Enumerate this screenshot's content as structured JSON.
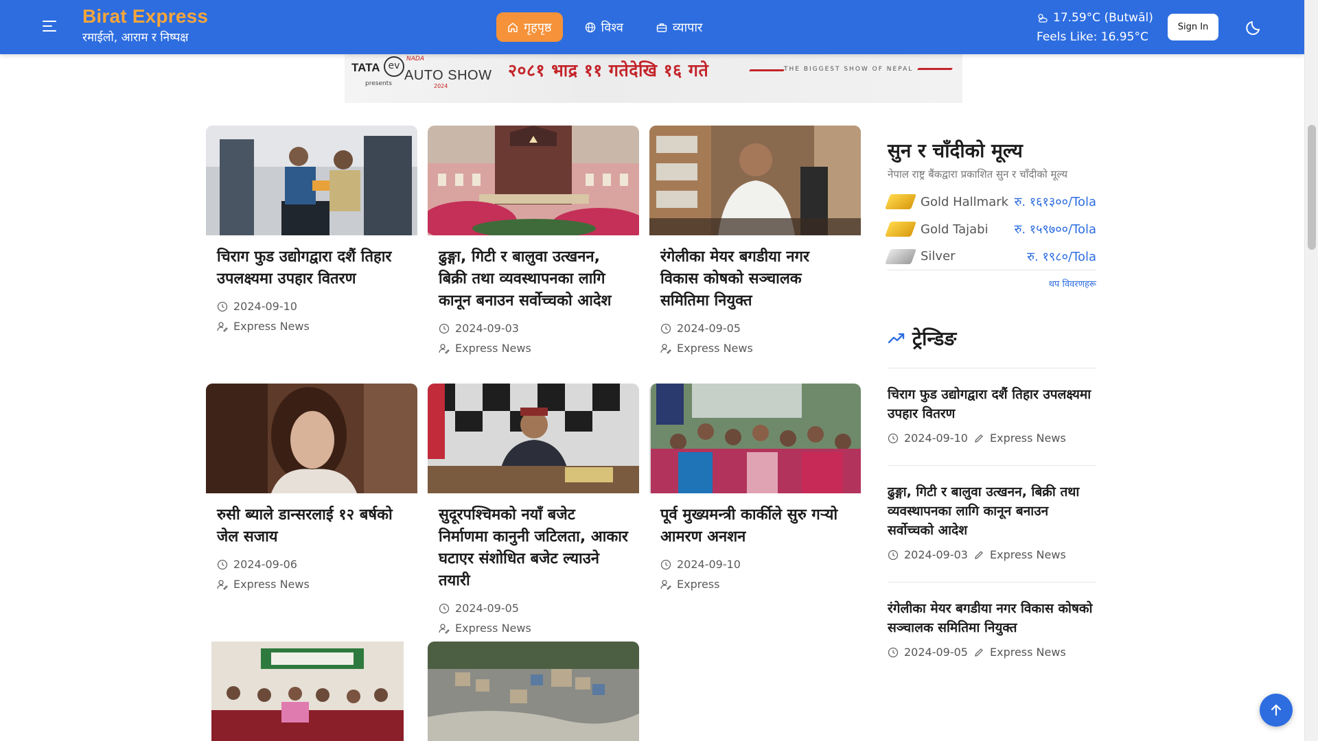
{
  "header": {
    "brand_name": "Birat Express",
    "brand_tagline": "रमाईलो, आराम र निष्पक्ष",
    "nav": [
      {
        "label": "गृहपृष्ठ",
        "icon": "home-icon",
        "active": true
      },
      {
        "label": "विश्व",
        "icon": "globe-icon",
        "active": false
      },
      {
        "label": "व्यापार",
        "icon": "briefcase-icon",
        "active": false
      }
    ],
    "weather_temp": "17.59°C (Butwāl)",
    "weather_feels": "Feels Like: 16.95°C",
    "signin_label": "Sign In",
    "accent_color": "#2d6de0",
    "active_tab_color": "#f6923a",
    "brand_color": "#f7a53a"
  },
  "banner": {
    "brand": "TATA",
    "ev": "ev",
    "presents": "presents",
    "show_name": "AUTO SHOW",
    "organizer": "NADA",
    "year": "2024",
    "dates": "२०८१ भाद्र ११ गतेदेखि १६ गते",
    "slogan": "THE BIGGEST SHOW OF NEPAL"
  },
  "articles": [
    {
      "title": "चिराग फुड उद्योगद्वारा दशैं तिहार उपलक्ष्यमा उपहार वितरण",
      "date": "2024-09-10",
      "author": "Express News"
    },
    {
      "title": "ढुङ्गा, गिटी र बालुवा उत्खनन, बिक्री तथा व्यवस्थापनका लागि कानून बनाउन सर्वोच्चको आदेश",
      "date": "2024-09-03",
      "author": "Express News"
    },
    {
      "title": "रंगेलीका मेयर बगडीया नगर विकास कोषको सञ्चालक समितिमा नियुक्त",
      "date": "2024-09-05",
      "author": "Express News"
    },
    {
      "title": "रुसी ब्याले डान्सरलाई १२ बर्षको जेल सजाय",
      "date": "2024-09-06",
      "author": "Express News"
    },
    {
      "title": "सुदूरपश्चिमको नयाँ बजेट निर्माणमा कानुनी जटिलता, आकार घटाएर संशोधित बजेट ल्याउने तयारी",
      "date": "2024-09-05",
      "author": "Express News"
    },
    {
      "title": "पूर्व मुख्यमन्त्री कार्कीले सुरु गर्‍यो आमरण अनशन",
      "date": "2024-09-10",
      "author": "Express"
    }
  ],
  "metals": {
    "title": "सुन र चाँदीको मूल्य",
    "subtitle": "नेपाल राष्ट्र बैंकद्वारा प्रकाशित सुन र चाँदीको मूल्य",
    "rows": [
      {
        "name": "Gold Hallmark",
        "price": "रु. १६१३००/Tola",
        "color": "#e8b21d"
      },
      {
        "name": "Gold Tajabi",
        "price": "रु. १५९७००/Tola",
        "color": "#e8b21d"
      },
      {
        "name": "Silver",
        "price": "रु. १९८०/Tola",
        "color": "#b8b8b8"
      }
    ],
    "more_link": "थप विवरणहरू"
  },
  "trending": {
    "title": "ट्रेन्डिङ",
    "items": [
      {
        "title": "चिराग फुड उद्योगद्वारा दशैं तिहार उपलक्ष्यमा उपहार वितरण",
        "date": "2024-09-10",
        "author": "Express News"
      },
      {
        "title": "ढुङ्गा, गिटी र बालुवा उत्खनन, बिक्री तथा व्यवस्थापनका लागि कानून बनाउन सर्वोच्चको आदेश",
        "date": "2024-09-03",
        "author": "Express News"
      },
      {
        "title": "रंगेलीका मेयर बगडीया नगर विकास कोषको सञ्चालक समितिमा नियुक्त",
        "date": "2024-09-05",
        "author": "Express News"
      }
    ]
  }
}
